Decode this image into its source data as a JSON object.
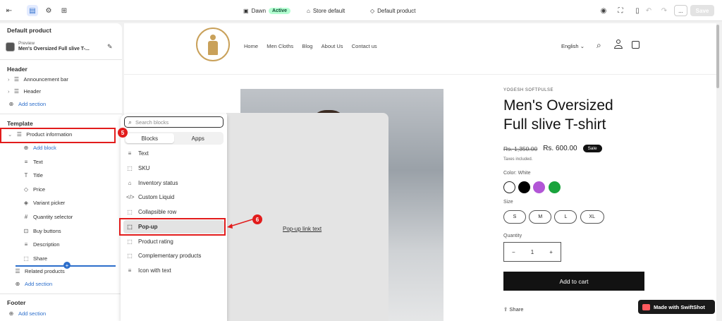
{
  "topbar": {
    "theme_name": "Dawn",
    "theme_status": "Active",
    "store_label": "Store default",
    "template_label": "Default product",
    "save_label": "Save",
    "more_label": "..."
  },
  "sidebar": {
    "title": "Default product",
    "preview_caption": "Preview",
    "preview_value": "Men's Oversized Full slive T-...",
    "header_heading": "Header",
    "header_items": [
      "Announcement bar",
      "Header"
    ],
    "add_section": "Add section",
    "template_heading": "Template",
    "product_info": "Product information",
    "add_block": "Add block",
    "blocks": [
      "Text",
      "Title",
      "Price",
      "Variant picker",
      "Quantity selector",
      "Buy buttons",
      "Description",
      "Share"
    ],
    "related": "Related products",
    "footer_heading": "Footer"
  },
  "picker": {
    "search_placeholder": "Search blocks",
    "tab_blocks": "Blocks",
    "tab_apps": "Apps",
    "items": [
      "Text",
      "SKU",
      "Inventory status",
      "Custom Liquid",
      "Collapsible row",
      "Pop-up",
      "Product rating",
      "Complementary products",
      "Icon with text"
    ],
    "popup_link_text": "Pop-up link text"
  },
  "callouts": {
    "step5": "5",
    "step6": "6"
  },
  "store": {
    "nav": [
      "Home",
      "Men Cloths",
      "Blog",
      "About Us",
      "Contact us"
    ],
    "language": "English",
    "vendor": "YOGESH SOFTPULSE",
    "title_line1": "Men's Oversized",
    "title_line2": "Full slive T-shirt",
    "price_compare": "Rs. 1,350.00",
    "price": "Rs. 600.00",
    "sale_badge": "Sale",
    "tax_note": "Taxes included.",
    "color_label": "Color: White",
    "colors": [
      "#ffffff",
      "#000000",
      "#b256d6",
      "#19a33c"
    ],
    "size_label": "Size",
    "sizes": [
      "S",
      "M",
      "L",
      "XL"
    ],
    "quantity_label": "Quantity",
    "qty_minus": "−",
    "quantity": "1",
    "qty_plus": "+",
    "add_to_cart": "Add to cart",
    "share": "Share"
  },
  "watermark": "Made with SwiftShot",
  "colors": {
    "accent": "#2c6ecb",
    "highlight": "#e21c1c",
    "active_badge": "#b4fed2"
  }
}
